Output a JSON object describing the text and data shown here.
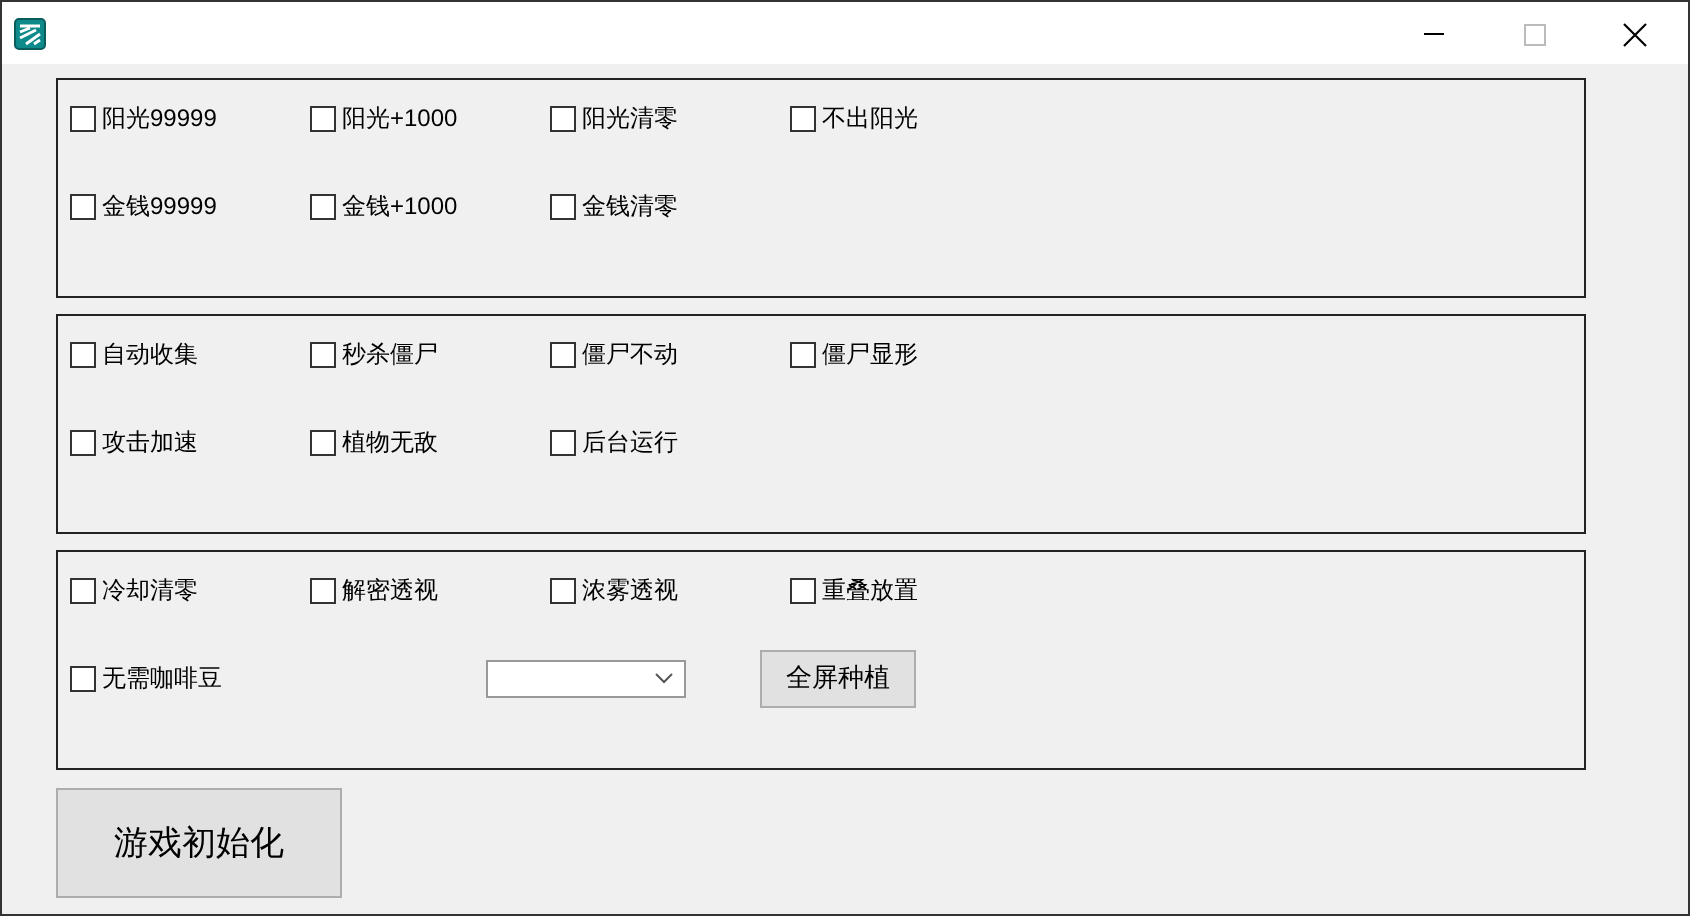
{
  "groups": [
    {
      "rows": [
        [
          {
            "kind": "checkbox",
            "label": "阳光99999",
            "checked": false
          },
          {
            "kind": "checkbox",
            "label": "阳光+1000",
            "checked": false
          },
          {
            "kind": "checkbox",
            "label": "阳光清零",
            "checked": false
          },
          {
            "kind": "checkbox",
            "label": "不出阳光",
            "checked": false
          }
        ],
        [
          {
            "kind": "checkbox",
            "label": "金钱99999",
            "checked": false
          },
          {
            "kind": "checkbox",
            "label": "金钱+1000",
            "checked": false
          },
          {
            "kind": "checkbox",
            "label": "金钱清零",
            "checked": false
          }
        ]
      ]
    },
    {
      "rows": [
        [
          {
            "kind": "checkbox",
            "label": "自动收集",
            "checked": false
          },
          {
            "kind": "checkbox",
            "label": "秒杀僵尸",
            "checked": false
          },
          {
            "kind": "checkbox",
            "label": "僵尸不动",
            "checked": false
          },
          {
            "kind": "checkbox",
            "label": "僵尸显形",
            "checked": false
          }
        ],
        [
          {
            "kind": "checkbox",
            "label": "攻击加速",
            "checked": false
          },
          {
            "kind": "checkbox",
            "label": "植物无敌",
            "checked": false
          },
          {
            "kind": "checkbox",
            "label": "后台运行",
            "checked": false
          }
        ]
      ]
    },
    {
      "rows": [
        [
          {
            "kind": "checkbox",
            "label": "冷却清零",
            "checked": false
          },
          {
            "kind": "checkbox",
            "label": "解密透视",
            "checked": false
          },
          {
            "kind": "checkbox",
            "label": "浓雾透视",
            "checked": false
          },
          {
            "kind": "checkbox",
            "label": "重叠放置",
            "checked": false
          }
        ],
        [
          {
            "kind": "checkbox",
            "label": "无需咖啡豆",
            "checked": false
          }
        ]
      ],
      "tools": [
        {
          "kind": "dropdown"
        },
        {
          "kind": "button",
          "label": "全屏种植"
        }
      ]
    }
  ],
  "init_button": {
    "label": "游戏初始化"
  }
}
